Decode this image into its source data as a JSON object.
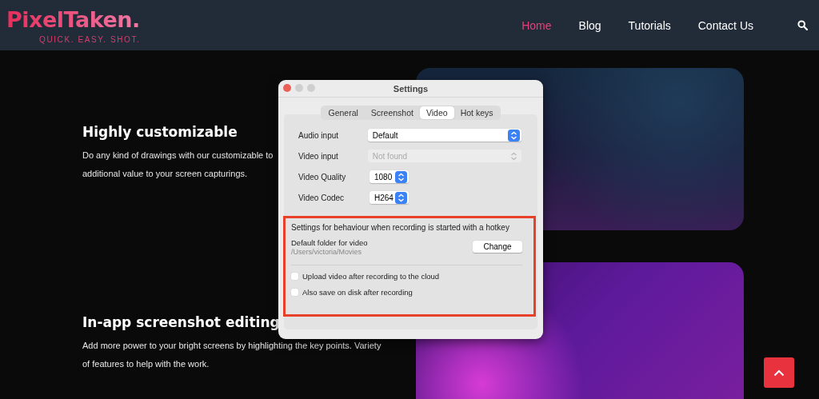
{
  "header": {
    "logo": "PixelTaken.",
    "tagline": "QUICK. EASY. SHOT.",
    "nav": [
      {
        "label": "Home",
        "selected": true
      },
      {
        "label": "Blog",
        "selected": false
      },
      {
        "label": "Tutorials",
        "selected": false
      },
      {
        "label": "Contact Us",
        "selected": false
      }
    ]
  },
  "features": [
    {
      "title": "Highly customizable",
      "lines": [
        "Do any kind of drawings with our customizable to",
        "additional value to your screen capturings."
      ]
    },
    {
      "title": "In-app screenshot editing",
      "lines": [
        "Add more power to your bright screens by highlighting the key points. Variety",
        "of features to help with the work."
      ]
    }
  ],
  "settings_window": {
    "title": "Settings",
    "tabs": [
      {
        "label": "General",
        "selected": false
      },
      {
        "label": "Screenshot",
        "selected": false
      },
      {
        "label": "Video",
        "selected": true
      },
      {
        "label": "Hot keys",
        "selected": false
      }
    ],
    "fields": [
      {
        "label": "Audio input",
        "value": "Default",
        "kind": "wide",
        "disabled": false
      },
      {
        "label": "Video input",
        "value": "Not found",
        "kind": "wide",
        "disabled": true
      },
      {
        "label": "Video Quality",
        "value": "1080",
        "kind": "compact",
        "disabled": false
      },
      {
        "label": "Video Codec",
        "value": "H264",
        "kind": "compact",
        "disabled": false
      }
    ],
    "hotkey_section": {
      "highlighted": true,
      "heading": "Settings for behaviour when recording is started with a hotkey",
      "folder_label": "Default folder for video",
      "folder_path": "/Users/victoria/Movies",
      "change_button": "Change",
      "checkboxes": [
        {
          "label": "Upload video after recording to the cloud",
          "checked": false
        },
        {
          "label": "Also save on disk after recording",
          "checked": false
        }
      ]
    }
  }
}
